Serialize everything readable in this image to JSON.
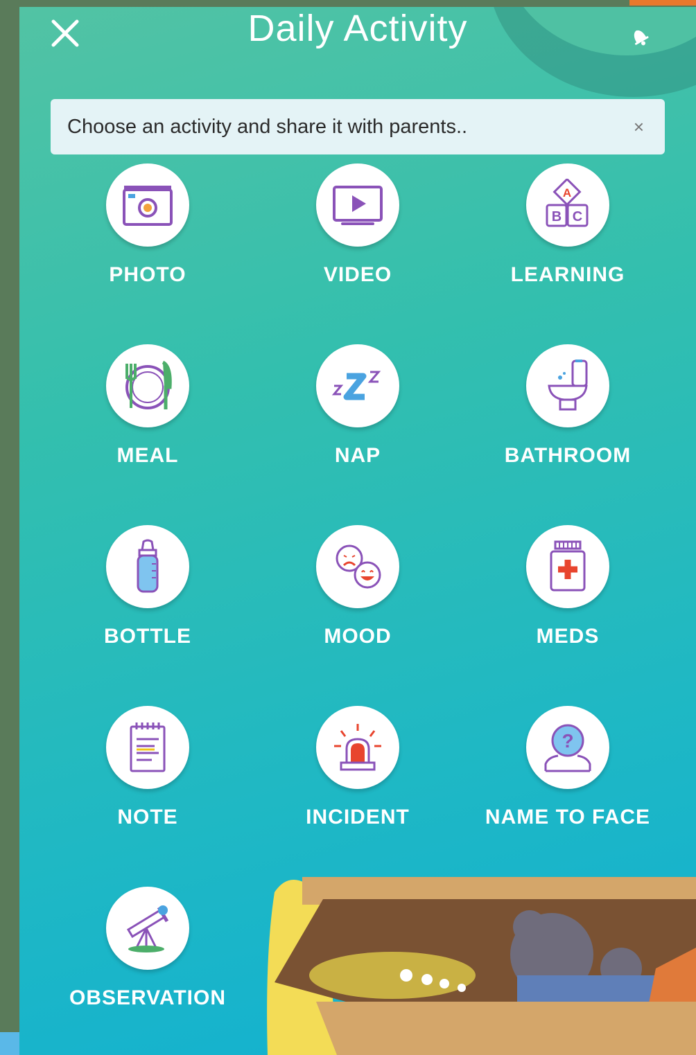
{
  "header": {
    "title": "Daily Activity"
  },
  "banner": {
    "text": "Choose an activity and share it with parents..",
    "close": "×"
  },
  "activities": [
    {
      "label": "PHOTO",
      "icon": "camera-icon"
    },
    {
      "label": "VIDEO",
      "icon": "video-play-icon"
    },
    {
      "label": "LEARNING",
      "icon": "abc-blocks-icon"
    },
    {
      "label": "MEAL",
      "icon": "plate-cutlery-icon"
    },
    {
      "label": "NAP",
      "icon": "sleep-zzz-icon"
    },
    {
      "label": "BATHROOM",
      "icon": "toilet-icon"
    },
    {
      "label": "BOTTLE",
      "icon": "baby-bottle-icon"
    },
    {
      "label": "MOOD",
      "icon": "mood-faces-icon"
    },
    {
      "label": "MEDS",
      "icon": "medicine-jar-icon"
    },
    {
      "label": "NOTE",
      "icon": "notepad-icon"
    },
    {
      "label": "INCIDENT",
      "icon": "siren-icon"
    },
    {
      "label": "NAME TO FACE",
      "icon": "question-person-icon"
    },
    {
      "label": "OBSERVATION",
      "icon": "telescope-icon"
    }
  ],
  "colors": {
    "accent_purple": "#8a52b8",
    "accent_blue": "#4aa3e0",
    "accent_green": "#4cae6a",
    "accent_red": "#e8452e",
    "accent_yellow": "#f2c417"
  }
}
